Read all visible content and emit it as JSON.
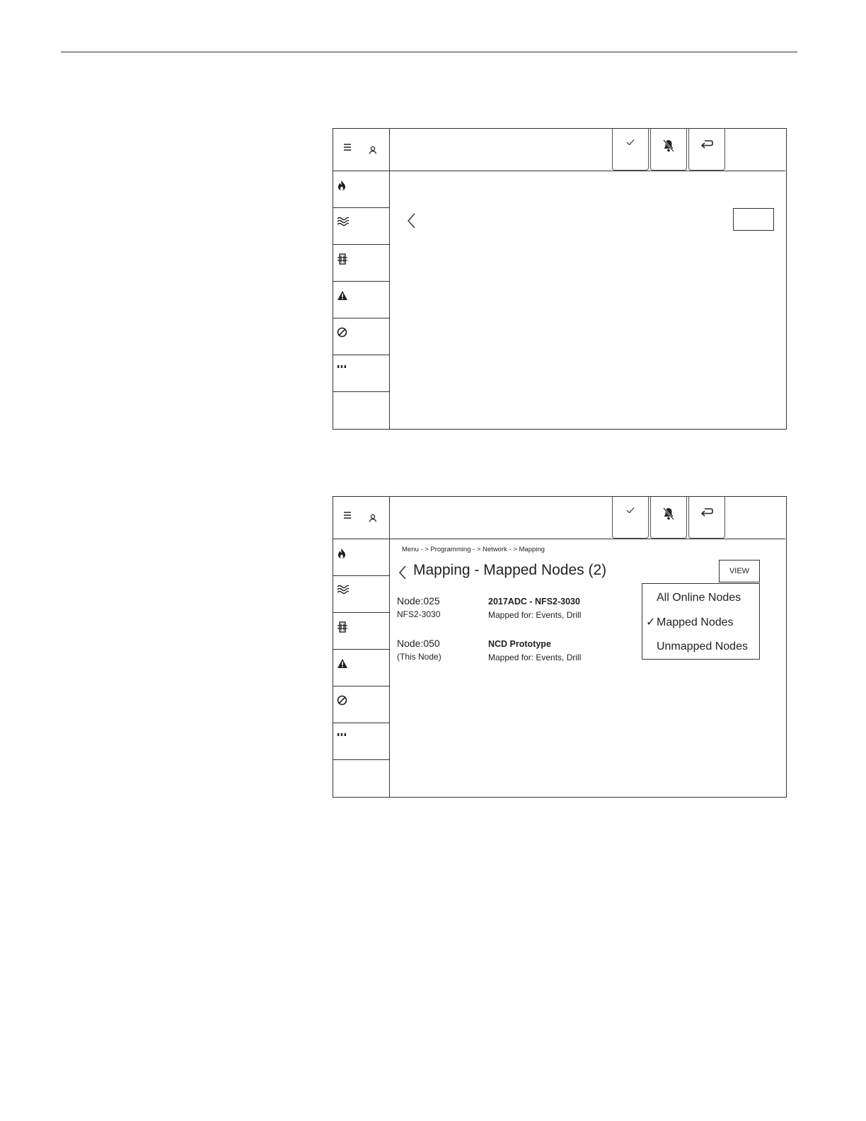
{
  "icons": {
    "sidebar_header": [
      "menu-icon",
      "user-icon"
    ],
    "sidebar_items": [
      "fire-icon",
      "wave-icon",
      "building-icon",
      "warning-icon",
      "disabled-icon",
      "more-icon"
    ],
    "toolbar": [
      "acknowledge-icon",
      "silence-icon",
      "reset-icon"
    ]
  },
  "panel2": {
    "breadcrumb": "Menu - > Programming - > Network - > Mapping",
    "title": "Mapping - Mapped Nodes (2)",
    "view_label": "VIEW",
    "dropdown": {
      "options": [
        "All Online Nodes",
        "Mapped Nodes",
        "Unmapped Nodes"
      ],
      "selected": "Mapped Nodes",
      "check": "✓"
    },
    "nodes": [
      {
        "id": "Node:025",
        "sub": "NFS2-3030",
        "name": "2017ADC - NFS2-3030",
        "mapped": "Mapped for: Events, Drill"
      },
      {
        "id": "Node:050",
        "sub": "(This Node)",
        "name": "NCD Prototype",
        "mapped": "Mapped for: Events, Drill"
      }
    ]
  }
}
